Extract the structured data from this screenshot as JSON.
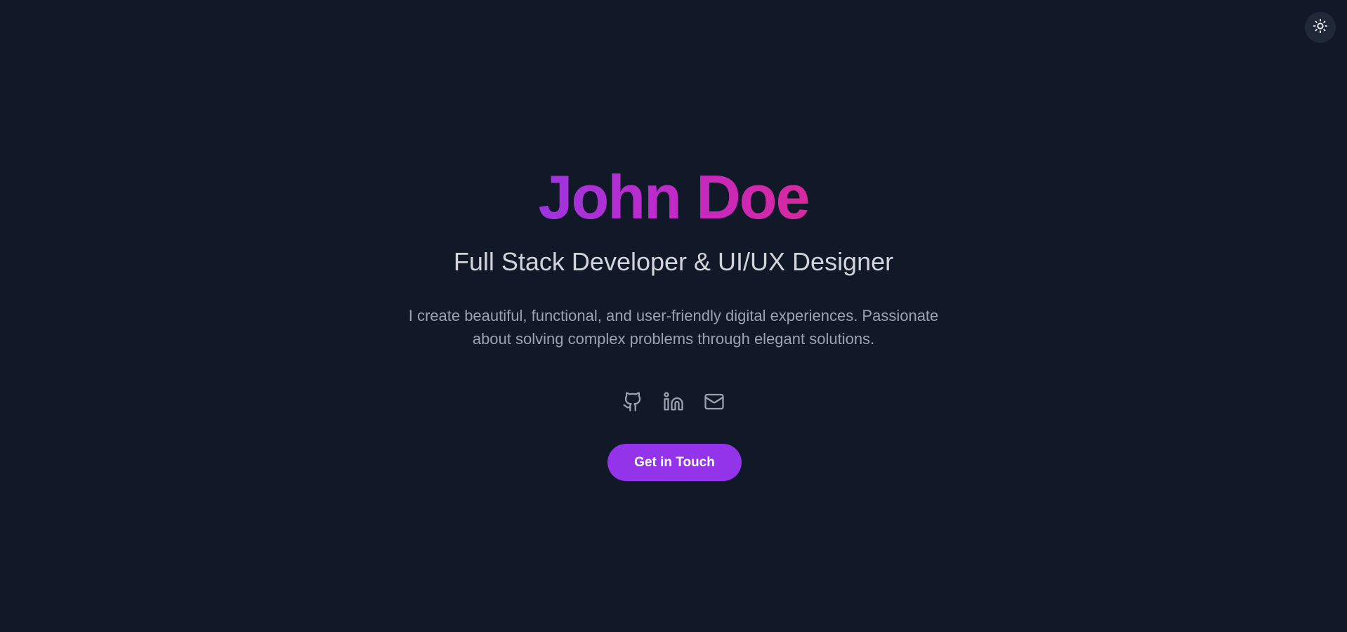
{
  "theme_toggle": {
    "icon": "sun-icon"
  },
  "hero": {
    "name": "John Doe",
    "role": "Full Stack Developer & UI/UX Designer",
    "bio": "I create beautiful, functional, and user-friendly digital experiences. Passionate about solving complex problems through elegant solutions."
  },
  "socials": [
    {
      "icon": "github-icon"
    },
    {
      "icon": "linkedin-icon"
    },
    {
      "icon": "mail-icon"
    }
  ],
  "cta": {
    "label": "Get in Touch"
  },
  "colors": {
    "background": "#111827",
    "accent": "#9333ea",
    "gradient_start": "#9d34e0",
    "gradient_end": "#d6299c",
    "role_text": "#d1d5db",
    "bio_text": "#9ca3af",
    "icon": "#9ca3af"
  }
}
